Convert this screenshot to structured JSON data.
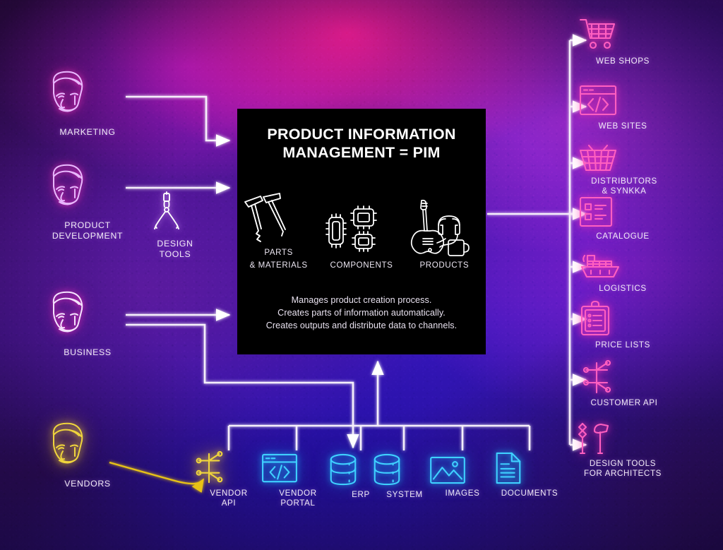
{
  "diagram": {
    "title": "Product Information Management = PIM",
    "colors": {
      "pink": "#ff2fae",
      "cyan": "#29c6ff",
      "gold": "#e8c319",
      "white": "#ffffff",
      "blue_arrow": "#1f7fd6",
      "panel_bg": "#000000"
    }
  },
  "center": {
    "title_line1": "PRODUCT INFORMATION",
    "title_line2": "MANAGEMENT = PIM",
    "columns": [
      {
        "label": "PARTS\n& MATERIALS",
        "icon": "nails-icon"
      },
      {
        "label": "COMPONENTS",
        "icon": "microchips-icon"
      },
      {
        "label": "PRODUCTS",
        "icon": "guitar-headphones-mug-icon"
      }
    ],
    "description_lines": [
      "Manages product creation process.",
      "Creates parts of information automatically.",
      "Creates outputs and distribute data to channels."
    ]
  },
  "inputs": [
    {
      "label": "MARKETING",
      "icon": "face-icon",
      "color": "#e9d8ff"
    },
    {
      "label": "PRODUCT\nDEVELOPMENT",
      "icon": "face-icon",
      "color": "#e9d8ff"
    },
    {
      "label": "BUSINESS",
      "icon": "face-icon",
      "color": "#f3e6ff"
    },
    {
      "label": "VENDORS",
      "icon": "face-icon",
      "color": "#e8c319"
    }
  ],
  "tools": [
    {
      "label": "DESIGN\nTOOLS",
      "icon": "compass-divider-icon",
      "color": "#ffffff"
    }
  ],
  "outputs": [
    {
      "label": "WEB SHOPS",
      "icon": "shopping-cart-icon"
    },
    {
      "label": "WEB SITES",
      "icon": "code-window-icon"
    },
    {
      "label": "DISTRIBUTORS\n& SYNKKA",
      "icon": "basket-icon"
    },
    {
      "label": "CATALOGUE",
      "icon": "checklist-icon"
    },
    {
      "label": "LOGISTICS",
      "icon": "cargo-ship-icon"
    },
    {
      "label": "PRICE LISTS",
      "icon": "clipboard-icon"
    },
    {
      "label": "CUSTOMER API",
      "icon": "api-node-icon"
    },
    {
      "label": "DESIGN TOOLS\nFOR ARCHITECTS",
      "icon": "wrench-hammer-icon"
    }
  ],
  "sources": [
    {
      "label": "VENDOR\nAPI",
      "icon": "api-node-icon",
      "color": "#e8c319"
    },
    {
      "label": "VENDOR\nPORTAL",
      "icon": "code-window-icon",
      "color": "#29c6ff"
    },
    {
      "label": "ERP",
      "icon": "database-icon",
      "color": "#29c6ff"
    },
    {
      "label": "SYSTEM",
      "icon": "database-icon",
      "color": "#29c6ff"
    },
    {
      "label": "IMAGES",
      "icon": "image-icon",
      "color": "#29c6ff"
    },
    {
      "label": "DOCUMENTS",
      "icon": "document-icon",
      "color": "#29c6ff"
    }
  ]
}
